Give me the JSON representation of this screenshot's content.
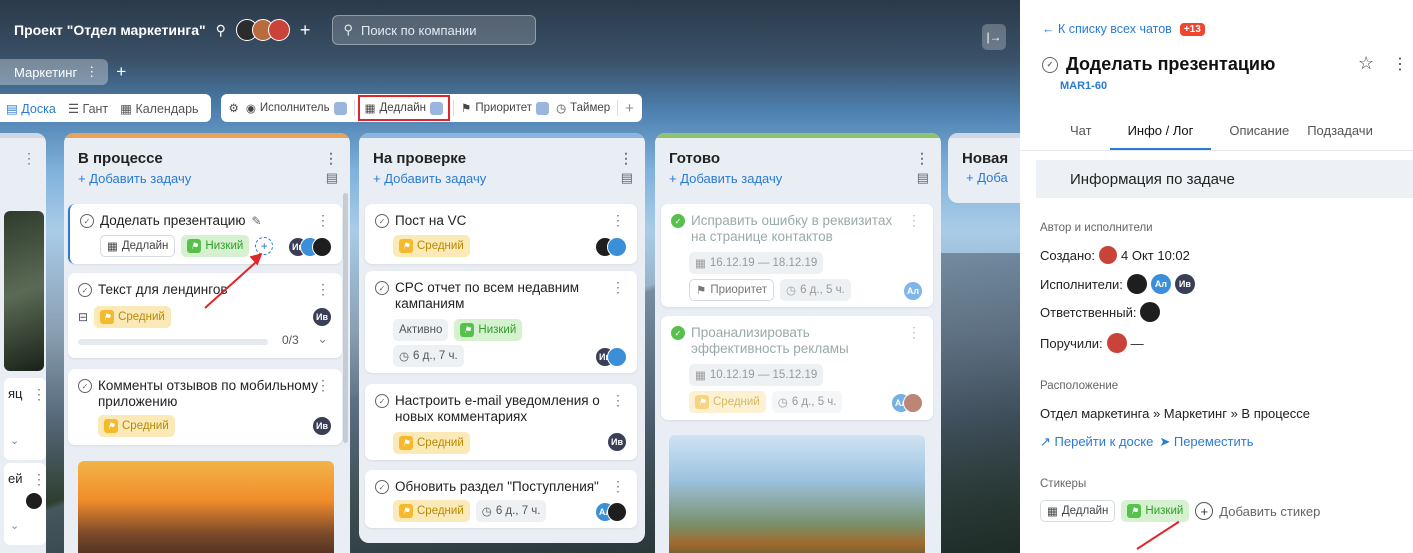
{
  "header": {
    "project_title": "Проект \"Отдел маркетинга\"",
    "search_placeholder": "Поиск по компании"
  },
  "tabs": {
    "active": "Маркетинг"
  },
  "views": {
    "board": "Доска",
    "gantt": "Гант",
    "calendar": "Календарь"
  },
  "filters": {
    "assignee": "Исполнитель",
    "deadline": "Дедлайн",
    "priority": "Приоритет",
    "timer": "Таймер"
  },
  "columns": {
    "add_task": "+ Добавить задачу",
    "in_progress": "В процессе",
    "review": "На проверке",
    "done": "Готово",
    "new": "Новая",
    "add_short": "+ Доба"
  },
  "left_fragments": {
    "a": "яц",
    "b": "ей"
  },
  "cards": {
    "c1": {
      "title": "Доделать презентацию",
      "deadline": "Дедлайн",
      "priority": "Низкий",
      "avatar": "Ив"
    },
    "c2": {
      "title": "Текст для лендингов",
      "priority": "Средний",
      "progress": "0/3",
      "avatar": "Ив"
    },
    "c3": {
      "title": "Комменты отзывов по мобильному приложению",
      "priority": "Средний",
      "avatar": "Ив"
    },
    "r1": {
      "title": "Пост на VC",
      "priority": "Средний"
    },
    "r2": {
      "title": "CPC отчет по всем недавним кампаниям",
      "status": "Активно",
      "priority": "Низкий",
      "time": "6 д., 7 ч.",
      "avatar": "Ив"
    },
    "r3": {
      "title": "Настроить e-mail уведомления о новых комментариях",
      "priority": "Средний",
      "avatar": "Ив"
    },
    "r4": {
      "title": "Обновить раздел \"Поступления\"",
      "priority": "Средний",
      "time": "6 д., 7 ч.",
      "avatar": "Ал"
    },
    "d1": {
      "title": "Исправить ошибку в реквизитах на странице контактов",
      "dates": "16.12.19 — 18.12.19",
      "priority": "Приоритет",
      "time": "6 д., 5 ч.",
      "avatar": "Ал"
    },
    "d2": {
      "title": "Проанализировать эффективность рекламы",
      "dates": "10.12.19 — 15.12.19",
      "priority": "Средний",
      "time": "6 д., 5 ч.",
      "avatar": "Ал"
    }
  },
  "panel": {
    "back": "← К списку всех чатов",
    "badge": "+13",
    "task_title": "Доделать презентацию",
    "task_id": "MAR1-60",
    "tabs": [
      "Чат",
      "Инфо / Лог",
      "Описание",
      "Подзадачи"
    ],
    "info_title": "Информация по задаче",
    "authors_label": "Автор и исполнители",
    "created_label": "Создано:",
    "created_value": "4 Окт 10:02",
    "assignees_label": "Исполнители:",
    "responsible_label": "Ответственный:",
    "delegated_label": "Поручили:",
    "delegated_value": "—",
    "location_label": "Расположение",
    "location_value": "Отдел маркетинга » Маркетинг » В процессе",
    "go_board": "Перейти к доске",
    "move": "Переместить",
    "stickers_label": "Стикеры",
    "sticker_deadline": "Дедлайн",
    "sticker_priority": "Низкий",
    "add_sticker": "Добавить стикер"
  },
  "avatars": {
    "al": "Ал",
    "iv": "Ив"
  },
  "colors": {
    "accent": "#2a7ad6",
    "green": "#58c04c",
    "yellow": "#f4b92c",
    "red": "#e0262b",
    "strip_orange": "#e9a25b",
    "strip_blue": "#8db3e0",
    "strip_green": "#8fc46f"
  }
}
